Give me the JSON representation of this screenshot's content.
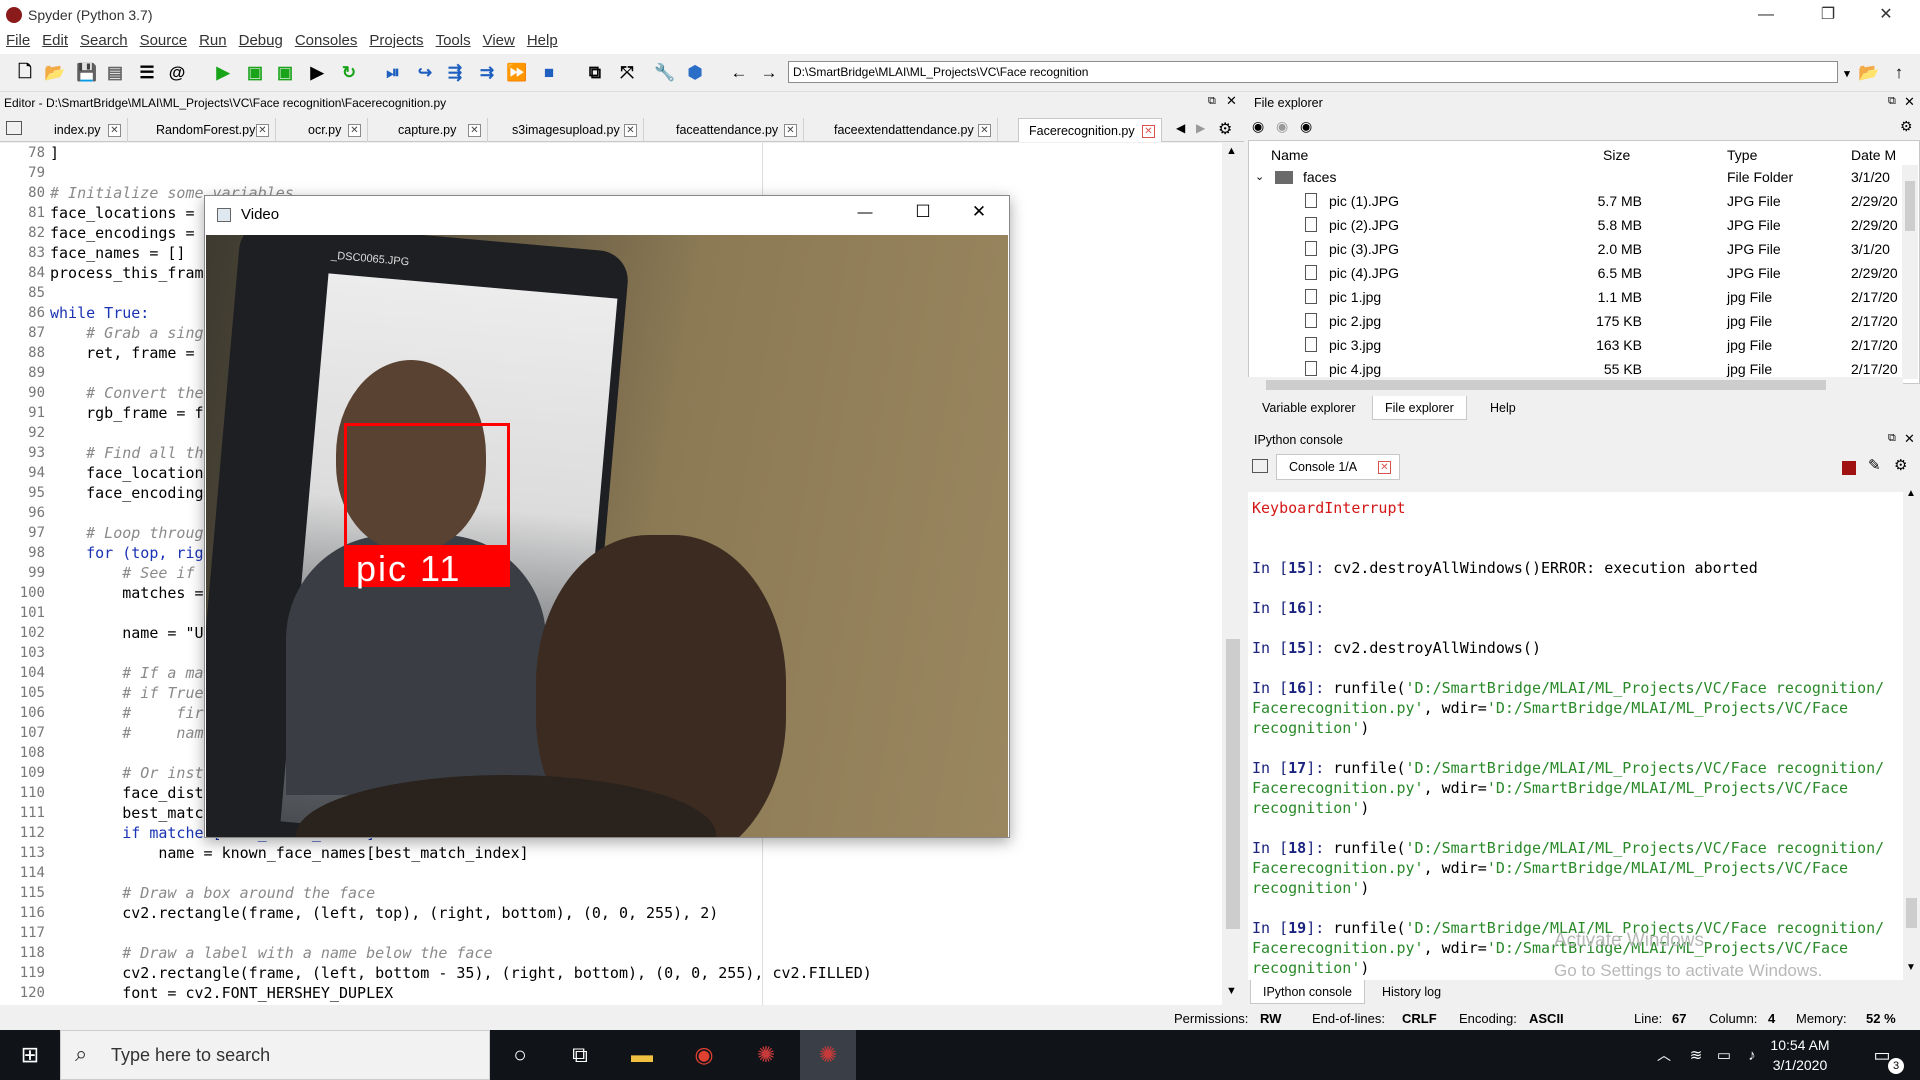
{
  "window": {
    "title": "Spyder (Python 3.7)",
    "min": "—",
    "max": "❐",
    "close": "✕"
  },
  "menu": [
    "File",
    "Edit",
    "Search",
    "Source",
    "Run",
    "Debug",
    "Consoles",
    "Projects",
    "Tools",
    "View",
    "Help"
  ],
  "toolbar": {
    "path": "D:\\SmartBridge\\MLAI\\ML_Projects\\VC\\Face recognition"
  },
  "editor": {
    "header": "Editor - D:\\SmartBridge\\MLAI\\ML_Projects\\VC\\Face recognition\\Facerecognition.py",
    "tabs": [
      "index.py",
      "RandomForest.py",
      "ocr.py",
      "capture.py",
      "s3imagesupload.py",
      "faceattendance.py",
      "faceextendattendance.py",
      "Facerecognition.py"
    ],
    "lines": [
      {
        "n": "78",
        "t": "]"
      },
      {
        "n": "79",
        "t": ""
      },
      {
        "n": "80",
        "t": "# Initialize some variables"
      },
      {
        "n": "81",
        "t": "face_locations = []"
      },
      {
        "n": "82",
        "t": "face_encodings = []"
      },
      {
        "n": "83",
        "t": "face_names = []"
      },
      {
        "n": "84",
        "t": "process_this_frame = True"
      },
      {
        "n": "85",
        "t": ""
      },
      {
        "n": "86",
        "t": "while True:"
      },
      {
        "n": "87",
        "t": "    # Grab a single frame of video"
      },
      {
        "n": "88",
        "t": "    ret, frame = video_capture.read()"
      },
      {
        "n": "89",
        "t": ""
      },
      {
        "n": "90",
        "t": "    # Convert the image from BGR color"
      },
      {
        "n": "91",
        "t": "    rgb_frame = frame[:, :, ::-1]"
      },
      {
        "n": "92",
        "t": ""
      },
      {
        "n": "93",
        "t": "    # Find all the faces and face encodings"
      },
      {
        "n": "94",
        "t": "    face_locations = face_recognition.face_locations(rgb_frame)"
      },
      {
        "n": "95",
        "t": "    face_encodings = face_recognition.face_encodings(rgb_frame, face_locations)"
      },
      {
        "n": "96",
        "t": ""
      },
      {
        "n": "97",
        "t": "    # Loop through each face in this frame"
      },
      {
        "n": "98",
        "t": "    for (top, right, bottom, left), face_encoding in zip(face_locations, face_encodings):"
      },
      {
        "n": "99",
        "t": "        # See if the face is a match"
      },
      {
        "n": "100",
        "t": "        matches = face_recognition.compare_faces(known_face_encodings, face_encoding)"
      },
      {
        "n": "101",
        "t": ""
      },
      {
        "n": "102",
        "t": "        name = \"Unknown\""
      },
      {
        "n": "103",
        "t": ""
      },
      {
        "n": "104",
        "t": "        # If a match was found in known_face_encodings"
      },
      {
        "n": "105",
        "t": "        # if True in matches:"
      },
      {
        "n": "106",
        "t": "        #     first_match_index = matches.index(True)"
      },
      {
        "n": "107",
        "t": "        #     name = known_face_names[first_match_index]"
      },
      {
        "n": "108",
        "t": ""
      },
      {
        "n": "109",
        "t": "        # Or instead, use the known face with the smallest distance"
      },
      {
        "n": "110",
        "t": "        face_distances = face_recognition.face_distance(known_face_encodings, face_encoding)"
      },
      {
        "n": "111",
        "t": "        best_match_index = np.argmin(face_distances)"
      },
      {
        "n": "112",
        "t": "        if matches[best_match_index]:"
      },
      {
        "n": "113",
        "t": "            name = known_face_names[best_match_index]"
      },
      {
        "n": "114",
        "t": ""
      },
      {
        "n": "115",
        "t": "        # Draw a box around the face"
      },
      {
        "n": "116",
        "t": "        cv2.rectangle(frame, (left, top), (right, bottom), (0, 0, 255), 2)"
      },
      {
        "n": "117",
        "t": ""
      },
      {
        "n": "118",
        "t": "        # Draw a label with a name below the face"
      },
      {
        "n": "119",
        "t": "        cv2.rectangle(frame, (left, bottom - 35), (right, bottom), (0, 0, 255), cv2.FILLED)"
      },
      {
        "n": "120",
        "t": "        font = cv2.FONT_HERSHEY_DUPLEX"
      }
    ]
  },
  "video": {
    "title": "Video",
    "min": "—",
    "max": "☐",
    "close": "✕",
    "face_label": "pic 11",
    "phone_caption": "_DSC0065.JPG"
  },
  "file_explorer": {
    "header": "File explorer",
    "columns": {
      "name": "Name",
      "size": "Size",
      "type": "Type",
      "date": "Date M"
    },
    "rows": [
      {
        "name": "faces",
        "size": "",
        "type": "File Folder",
        "date": "3/1/20"
      },
      {
        "name": "pic (1).JPG",
        "size": "5.7 MB",
        "type": "JPG File",
        "date": "2/29/20"
      },
      {
        "name": "pic (2).JPG",
        "size": "5.8 MB",
        "type": "JPG File",
        "date": "2/29/20"
      },
      {
        "name": "pic (3).JPG",
        "size": "2.0 MB",
        "type": "JPG File",
        "date": "3/1/20"
      },
      {
        "name": "pic (4).JPG",
        "size": "6.5 MB",
        "type": "JPG File",
        "date": "2/29/20"
      },
      {
        "name": "pic 1.jpg",
        "size": "1.1 MB",
        "type": "jpg File",
        "date": "2/17/20"
      },
      {
        "name": "pic 2.jpg",
        "size": "175 KB",
        "type": "jpg File",
        "date": "2/17/20"
      },
      {
        "name": "pic 3.jpg",
        "size": "163 KB",
        "type": "jpg File",
        "date": "2/17/20"
      },
      {
        "name": "pic 4.jpg",
        "size": "55 KB",
        "type": "jpg File",
        "date": "2/17/20"
      }
    ],
    "tabs": [
      "Variable explorer",
      "File explorer",
      "Help"
    ]
  },
  "console": {
    "header": "IPython console",
    "tab": "Console 1/A",
    "lines": [
      {
        "kind": "err",
        "text": "KeyboardInterrupt"
      },
      {
        "kind": "blank",
        "text": ""
      },
      {
        "kind": "blank",
        "text": ""
      },
      {
        "kind": "in",
        "prompt": "In [",
        "num": "15",
        "close": "]: ",
        "text": "cv2.destroyAllWindows()ERROR: execution aborted"
      },
      {
        "kind": "blank",
        "text": ""
      },
      {
        "kind": "in",
        "prompt": "In [",
        "num": "16",
        "close": "]:",
        "text": ""
      },
      {
        "kind": "blank",
        "text": ""
      },
      {
        "kind": "in",
        "prompt": "In [",
        "num": "15",
        "close": "]: ",
        "text": "cv2.destroyAllWindows()"
      },
      {
        "kind": "blank",
        "text": ""
      },
      {
        "kind": "run",
        "prompt": "In [",
        "num": "16",
        "close": "]: ",
        "a": "runfile(",
        "p1": "'D:/SmartBridge/MLAI/ML_Projects/VC/Face recognition/",
        "p2": "Facerecognition.py'",
        "b": ", wdir=",
        "p3": "'D:/SmartBridge/MLAI/ML_Projects/VC/Face",
        "p4": "recognition'",
        "c": ")"
      },
      {
        "kind": "blank",
        "text": ""
      },
      {
        "kind": "run",
        "prompt": "In [",
        "num": "17",
        "close": "]: ",
        "a": "runfile(",
        "p1": "'D:/SmartBridge/MLAI/ML_Projects/VC/Face recognition/",
        "p2": "Facerecognition.py'",
        "b": ", wdir=",
        "p3": "'D:/SmartBridge/MLAI/ML_Projects/VC/Face",
        "p4": "recognition'",
        "c": ")"
      },
      {
        "kind": "blank",
        "text": ""
      },
      {
        "kind": "run",
        "prompt": "In [",
        "num": "18",
        "close": "]: ",
        "a": "runfile(",
        "p1": "'D:/SmartBridge/MLAI/ML_Projects/VC/Face recognition/",
        "p2": "Facerecognition.py'",
        "b": ", wdir=",
        "p3": "'D:/SmartBridge/MLAI/ML_Projects/VC/Face",
        "p4": "recognition'",
        "c": ")"
      },
      {
        "kind": "blank",
        "text": ""
      },
      {
        "kind": "run",
        "prompt": "In [",
        "num": "19",
        "close": "]: ",
        "a": "runfile(",
        "p1": "'D:/SmartBridge/MLAI/ML_Projects/VC/Face recognition/",
        "p2": "Facerecognition.py'",
        "b": ", wdir=",
        "p3": "'D:/SmartBridge/MLAI/ML_Projects/VC/Face",
        "p4": "recognition'",
        "c": ")"
      }
    ],
    "bottom_tabs": [
      "IPython console",
      "History log"
    ]
  },
  "watermark": {
    "line1": "Activate Windows",
    "line2": "Go to Settings to activate Windows."
  },
  "status": {
    "perm_label": "Permissions:",
    "perm": "RW",
    "eol_label": "End-of-lines:",
    "eol": "CRLF",
    "enc_label": "Encoding:",
    "enc": "ASCII",
    "line_label": "Line:",
    "line": "67",
    "col_label": "Column:",
    "col": "4",
    "mem_label": "Memory:",
    "mem": "52 %"
  },
  "taskbar": {
    "search_placeholder": "Type here to search",
    "time": "10:54 AM",
    "date": "3/1/2020",
    "notifications": "3"
  }
}
